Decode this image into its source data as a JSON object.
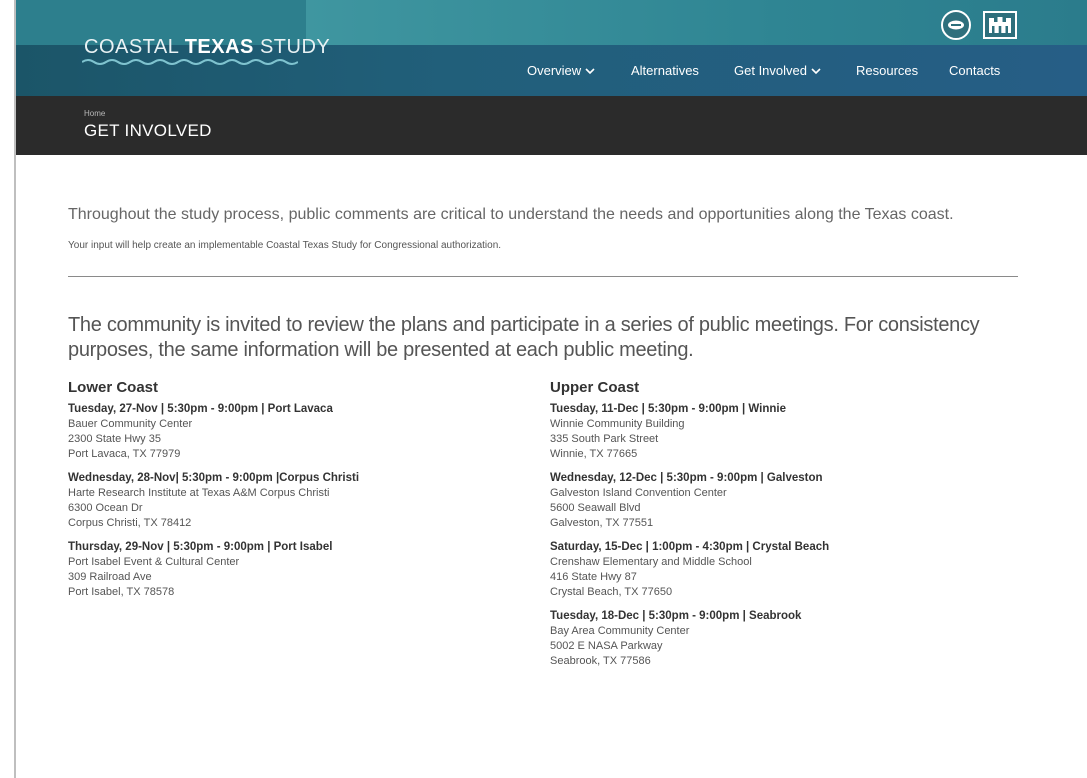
{
  "brand": {
    "prefix": "COASTAL ",
    "bold": "TEXAS",
    "suffix": " STUDY"
  },
  "icons": {
    "logo_left": "shield-seal-icon",
    "logo_right": "castle-icon",
    "dropdown": "chevron-down-icon"
  },
  "colors": {
    "header_teal": "#2d7f8d",
    "header_dark": "#215f7a",
    "titlebar": "#2b2b2b"
  },
  "nav": {
    "overview": "Overview",
    "alternatives": "Alternatives",
    "get_involved": "Get Involved",
    "resources": "Resources",
    "contacts": "Contacts"
  },
  "breadcrumb": "Home",
  "page_title": "GET INVOLVED",
  "intro": {
    "lead": "Throughout the study process, public comments are critical to understand the needs and opportunities along the Texas coast.",
    "small": "Your input will help create an implementable Coastal Texas Study for Congressional authorization."
  },
  "invite": "The community is invited to review the plans and participate in a series of public meetings. For consistency purposes, the same information will be presented at each public meeting.",
  "lower_coast": {
    "title": "Lower Coast",
    "meetings": [
      {
        "head": "Tuesday, 27-Nov | 5:30pm - 9:00pm | Port Lavaca",
        "venue": "Bauer Community Center",
        "street": "2300 State Hwy 35",
        "city": "Port Lavaca, TX 77979"
      },
      {
        "head": "Wednesday, 28-Nov| 5:30pm - 9:00pm |Corpus Christi",
        "venue": "Harte Research Institute at Texas A&M Corpus Christi",
        "street": "6300 Ocean Dr",
        "city": "Corpus Christi, TX 78412"
      },
      {
        "head": "Thursday, 29-Nov | 5:30pm - 9:00pm | Port Isabel",
        "venue": "Port Isabel Event & Cultural Center",
        "street": "309 Railroad Ave",
        "city": "Port Isabel, TX 78578"
      }
    ]
  },
  "upper_coast": {
    "title": "Upper Coast",
    "meetings": [
      {
        "head": "Tuesday, 11-Dec | 5:30pm - 9:00pm | Winnie",
        "venue": "Winnie Community Building",
        "street": "335 South Park Street",
        "city": "Winnie, TX 77665"
      },
      {
        "head": "Wednesday, 12-Dec | 5:30pm - 9:00pm | Galveston",
        "venue": "Galveston Island Convention Center",
        "street": "5600 Seawall Blvd",
        "city": "Galveston, TX 77551"
      },
      {
        "head": "Saturday, 15-Dec | 1:00pm - 4:30pm | Crystal Beach",
        "venue": "Crenshaw Elementary and Middle School",
        "street": "416 State Hwy 87",
        "city": "Crystal Beach, TX 77650"
      },
      {
        "head": "Tuesday, 18-Dec | 5:30pm - 9:00pm | Seabrook",
        "venue": "Bay Area Community Center",
        "street": "5002 E NASA Parkway",
        "city": "Seabrook, TX 77586"
      }
    ]
  }
}
